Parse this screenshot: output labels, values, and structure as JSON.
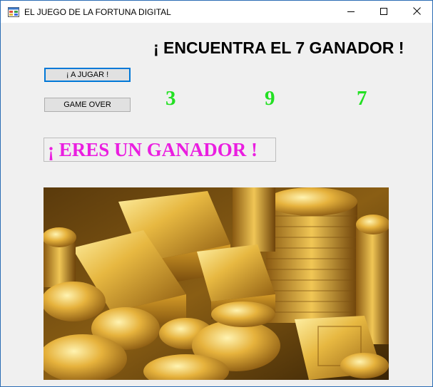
{
  "window": {
    "title": "EL JUEGO DE LA FORTUNA DIGITAL"
  },
  "main": {
    "heading": "¡ ENCUENTRA EL 7 GANADOR !",
    "play_button": "¡ A JUGAR !",
    "gameover_button": "GAME OVER",
    "digits": [
      "3",
      "9",
      "7"
    ],
    "result": "¡ ERES UN GANADOR !"
  },
  "colors": {
    "digit": "#22e022",
    "result": "#ea1ee0",
    "window_border": "#2b6cb4",
    "focused_button_border": "#0078d7"
  },
  "icons": [
    "app-icon",
    "minimize-icon",
    "maximize-icon",
    "close-icon"
  ]
}
